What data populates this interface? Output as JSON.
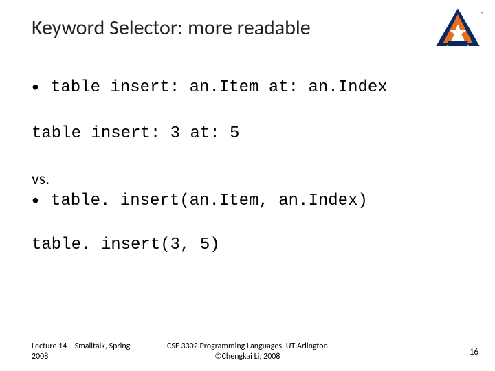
{
  "title": "Keyword Selector: more readable",
  "bullets": {
    "b1": "table insert: an.Item at: an.Index",
    "b1_sub": "table insert: 3 at: 5",
    "vs": "vs.",
    "b2": "table. insert(an.Item, an.Index)",
    "b2_sub": "table. insert(3, 5)"
  },
  "footer": {
    "left_line1": "Lecture 14 – Smalltalk, Spring",
    "left_line2": "2008",
    "center_line1": "CSE 3302 Programming Languages, UT-Arlington",
    "center_line2": "©Chengkai Li, 2008",
    "page": "16"
  },
  "logo": {
    "name": "uta-logo",
    "colors": {
      "blue": "#0a2a5e",
      "orange": "#e86d1f",
      "white": "#ffffff"
    }
  }
}
